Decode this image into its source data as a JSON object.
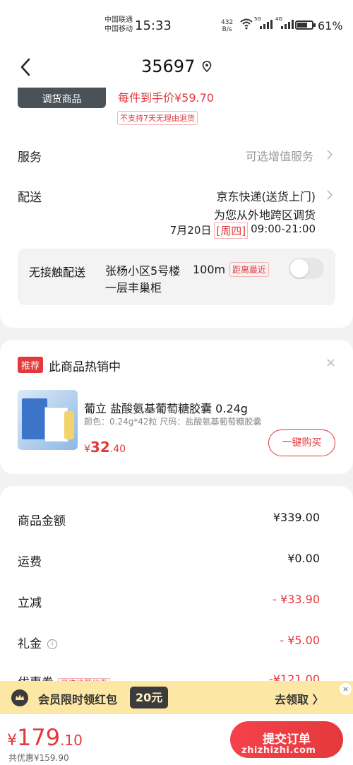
{
  "status_bar": {
    "carrier1": "中国联通",
    "carrier2": "中国移动",
    "time": "15:33",
    "net_speed_value": "432",
    "net_speed_unit": "B/s",
    "sig1_label": "5G",
    "sig2_label": "4G",
    "battery": "61%"
  },
  "header": {
    "title": "35697"
  },
  "product": {
    "thumb_label": "调货商品",
    "price_each": "每件到手价¥59.70",
    "no_return": "不支持7天无理由退货"
  },
  "service": {
    "label": "服务",
    "value": "可选增值服务"
  },
  "delivery": {
    "label": "配送",
    "method": "京东快递(送货上门)",
    "note": "为您从外地跨区调货",
    "date": "7月20日",
    "weekday": "[周四]",
    "time": "09:00-21:00"
  },
  "contactless": {
    "label": "无接触配送",
    "address": "张杨小区5号楼一层丰巢柜",
    "distance": "100m",
    "nearest": "距离最近"
  },
  "recommend": {
    "badge": "推荐",
    "title": "此商品热销中",
    "close": "×",
    "name": "葡立 盐酸氨基葡萄糖胶囊 0.24g",
    "spec": "颜色：0.24g*42粒   尺码：盐酸氨基葡萄糖胶囊",
    "price_symbol": "¥",
    "price_int": "32",
    "price_dec": ".40",
    "buy_label": "一键购买"
  },
  "fees": [
    {
      "label": "商品金额",
      "value": "¥339.00"
    },
    {
      "label": "运费",
      "value": "¥0.00"
    },
    {
      "label": "立减",
      "value": "- ¥33.90"
    },
    {
      "label": "礼金",
      "value": "- ¥5.00"
    },
    {
      "label": "优惠券",
      "tag": "已选推荐优惠",
      "value": "-¥121.00"
    }
  ],
  "promo": {
    "text": "会员限时领红包",
    "amount": "20元",
    "go": "去领取 〉",
    "close": "×"
  },
  "bottom": {
    "yen": "¥",
    "total_int": "179",
    "total_dec": ".10",
    "saved": "共优惠¥159.90",
    "submit": "提交订单",
    "watermark": "zhizhizhi.com"
  },
  "colors": {
    "accent": "#e4393c",
    "promo_bg": "#fde7a4"
  }
}
